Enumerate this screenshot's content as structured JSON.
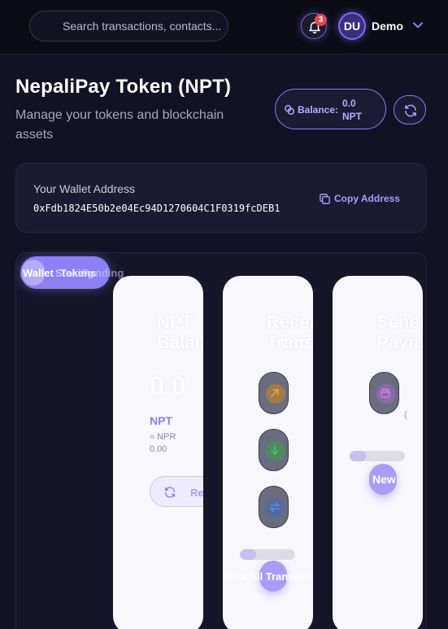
{
  "header": {
    "search_placeholder": "Search transactions, contacts...",
    "notification_count": "3",
    "avatar_initials": "DU",
    "username": "Demo"
  },
  "page": {
    "title": "NepaliPay Token (NPT)",
    "subtitle": "Manage your tokens and blockchain assets",
    "balance_label": "Balance:",
    "balance_value": "0.0 NPT"
  },
  "wallet": {
    "label": "Your Wallet Address",
    "address": "0xFdb1824E50b2e04Ec94D1270604C1F0319fcDEB1",
    "copy_label": "Copy Address"
  },
  "tabs": {
    "wallet": "Wallet",
    "staking": "Staking",
    "tokens": "Tokens",
    "funding": "Funding"
  },
  "cards": {
    "balance": {
      "title_line1": "NPT",
      "title_line2": "Balance",
      "amount": "0.0",
      "unit": "NPT",
      "npr_label": "≈ NPR",
      "npr_value": "0.00",
      "refresh_label": "Refresh"
    },
    "transactions": {
      "title_line1": "Recent",
      "title_line2": "Transactions",
      "progress_fraction": 0.3,
      "view_all_label": "View All Transactions"
    },
    "payments": {
      "title_line1": "Scheduled",
      "title_line2": "Payments",
      "progress_fraction": 0.3,
      "new_label": "New",
      "item_marker": "("
    }
  },
  "icons": {
    "search": "search-icon",
    "bell": "bell-icon",
    "chevron": "chevron-down-icon",
    "coins": "coins-icon",
    "refresh": "refresh-icon",
    "copy": "copy-icon",
    "send": "arrow-up-right-icon",
    "receive": "arrow-down-icon",
    "history": "swap-icon",
    "calendar": "calendar-icon"
  },
  "colors": {
    "accent": "#8d7ff5",
    "background": "#111223",
    "badge": "#e5484d"
  }
}
